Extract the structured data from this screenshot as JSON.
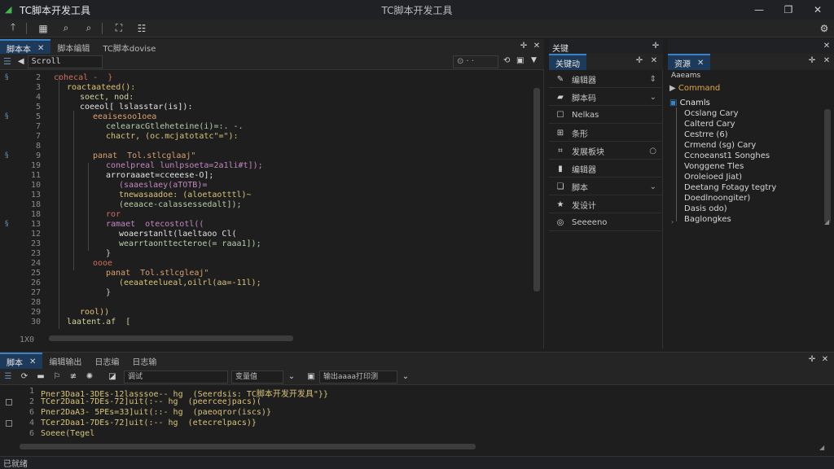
{
  "window": {
    "app_title": "TC脚本开发工具",
    "center_title": "TC脚本开发工具",
    "logo_icon": "leaf-icon",
    "controls": [
      "minimize-icon",
      "maximize-icon",
      "close-icon"
    ]
  },
  "toolbar": {
    "buttons": [
      {
        "name": "run-icon",
        "glyph": "↑"
      },
      {
        "name": "grid-icon",
        "glyph": "▦"
      },
      {
        "name": "search-icon",
        "glyph": "⌕"
      },
      {
        "name": "find-icon",
        "glyph": "⌕"
      },
      {
        "name": "debug-icon",
        "glyph": "⛶"
      },
      {
        "name": "settings-icon",
        "glyph": "☷"
      }
    ],
    "right_icon": "gear-icon"
  },
  "editor_tabs": {
    "tabs": [
      {
        "label": "脚本本",
        "active": true,
        "closable": true
      },
      {
        "label": "脚本编辑",
        "active": false,
        "closable": false
      },
      {
        "label": "TC脚本dovise",
        "active": false,
        "closable": false
      }
    ]
  },
  "editor": {
    "symbol_value": "Scroll",
    "lines": [
      {
        "n": "2",
        "text": "cohecal -  }",
        "color": "#d16c5f",
        "indent": 0
      },
      {
        "n": "3",
        "text": "roactaateed():",
        "color": "#e0c276",
        "indent": 1
      },
      {
        "n": "4",
        "text": "soect, nod:",
        "color": "#d2d2a0",
        "indent": 2
      },
      {
        "n": "5",
        "text": "coeeol[ lslasstar(is]):",
        "color": "#e2e2e2",
        "indent": 2
      },
      {
        "n": "5",
        "text": "eeaisesoo1oea",
        "color": "#d8a070",
        "indent": 3
      },
      {
        "n": "7",
        "text": "celearacGtleheteine(i)=:. -.",
        "color": "#b5cea8",
        "indent": 4
      },
      {
        "n": "7",
        "text": "chactr, (oc.mcjatotatc\"=\"):",
        "color": "#d8c27a",
        "indent": 4
      },
      {
        "n": "8",
        "text": "",
        "color": "#cfcfcf",
        "indent": 0
      },
      {
        "n": "9",
        "text": "panat  Tol.stlcglaaj\"",
        "color": "#d8a070",
        "indent": 3
      },
      {
        "n": "19",
        "text": "conelpreal lunlpsoeta=2a1li#t]);",
        "color": "#c586c0",
        "indent": 4
      },
      {
        "n": "11",
        "text": "arroraaaet=cceeese-O];",
        "color": "#e2e2e2",
        "indent": 4
      },
      {
        "n": "10",
        "text": "(saaeslaey(aTOTB)=",
        "color": "#c586c0",
        "indent": 5
      },
      {
        "n": "13",
        "text": "tnewasaadoe: (aloetaotttl)~",
        "color": "#d8c27a",
        "indent": 5
      },
      {
        "n": "18",
        "text": "(eeaace-calassessedalt]);",
        "color": "#b5cea8",
        "indent": 5
      },
      {
        "n": "18",
        "text": "ror",
        "color": "#d16c5f",
        "indent": 4
      },
      {
        "n": "13",
        "text": "ramaet  otecostotl((",
        "color": "#c586c0",
        "indent": 4
      },
      {
        "n": "12",
        "text": "woaerstanlt(laeltaoo Cl(",
        "color": "#e2e2e2",
        "indent": 5
      },
      {
        "n": "23",
        "text": "wearrtaonttecteroe(= raaa1]);",
        "color": "#b5cea8",
        "indent": 5
      },
      {
        "n": "23",
        "text": "}",
        "color": "#cfcfcf",
        "indent": 4
      },
      {
        "n": "24",
        "text": "oooe",
        "color": "#d16c5f",
        "indent": 3
      },
      {
        "n": "25",
        "text": "panat  Tol.stlcgleaj\"",
        "color": "#d8a070",
        "indent": 4
      },
      {
        "n": "26",
        "text": "(eeaateelueal,oilrl(aa=-11l);",
        "color": "#d8c27a",
        "indent": 5
      },
      {
        "n": "27",
        "text": "}",
        "color": "#cfcfcf",
        "indent": 4
      },
      {
        "n": "28",
        "text": "",
        "color": "#cfcfcf",
        "indent": 0
      },
      {
        "n": "29",
        "text": "rool))",
        "color": "#e0c276",
        "indent": 2
      },
      {
        "n": "30",
        "text": "laatent.af  [",
        "color": "#d2d2a0",
        "indent": 1
      }
    ],
    "bottom_line_number": "1X0"
  },
  "mid_panel": {
    "tabs": [
      {
        "label": "关键动",
        "active": true,
        "closable": false
      }
    ],
    "header_label": "关键",
    "items": [
      {
        "icon": "pencil-icon",
        "label": "编辑器",
        "trail": "⇕"
      },
      {
        "icon": "package-icon",
        "label": "脚本码",
        "trail": "⌄"
      },
      {
        "icon": "checkbox-icon",
        "label": "Nelkas",
        "trail": ""
      },
      {
        "icon": "plus-icon",
        "label": "条形",
        "trail": ""
      },
      {
        "icon": "tag-icon",
        "label": "发展板块",
        "trail": "○"
      },
      {
        "icon": "chart-icon",
        "label": "编辑器",
        "trail": ""
      },
      {
        "icon": "layers-icon",
        "label": "脚本",
        "trail": "⌄"
      },
      {
        "icon": "star-icon",
        "label": "发设计",
        "trail": ""
      },
      {
        "icon": "globe-icon",
        "label": "Seeeeno",
        "trail": ""
      }
    ]
  },
  "right_panel": {
    "tabs": [
      {
        "label": "资源",
        "active": true,
        "closable": true
      }
    ],
    "filter_text": "Aaeams",
    "selected": "Command",
    "tree_head": "Cnamls",
    "items": [
      "Ocslang Cary",
      "Calterd Cary",
      "Cestrre (6)",
      "Crmend (sg) Cary",
      "Ccnoeanst1 Songhes",
      "Vonggene Tles",
      "Oroleioed Jiat)",
      "Deetang Fotagy tegtry",
      "Doedlnoongiter)",
      "Dasis odo)",
      "Baglongkes"
    ]
  },
  "output": {
    "tabs": [
      {
        "label": "脚本",
        "active": true,
        "closable": true
      },
      {
        "label": "编辑输出",
        "active": false,
        "closable": false
      },
      {
        "label": "日志编",
        "active": false,
        "closable": false
      },
      {
        "label": "日志输",
        "active": false,
        "closable": false
      }
    ],
    "fields": {
      "a": "调试",
      "b": "变量值",
      "c": "输出aaaa打印测"
    },
    "lines": [
      {
        "n": "1",
        "text": "Pner3Daa1-3DEs-12lasssoe-- hg  (Seerdsis: TC脚本开发开发具\"}}",
        "mark": false
      },
      {
        "n": "2",
        "text": "TCer2Daa1-7DEs-72]uit(:-- hg  (peerceejpacs)(",
        "mark": true
      },
      {
        "n": "6",
        "text": "Pner2DaA3- 5PEs=33]uit(::- hg  (paeoqror(iscs)}",
        "mark": false
      },
      {
        "n": "4",
        "text": "TCer2Daa1-7DEs-72]uit(:-- hg  (etecrelpacs)}",
        "mark": true
      },
      {
        "n": "6",
        "text": "Soeee(Tegel",
        "mark": false
      }
    ]
  },
  "status": {
    "text": "已就绪"
  }
}
